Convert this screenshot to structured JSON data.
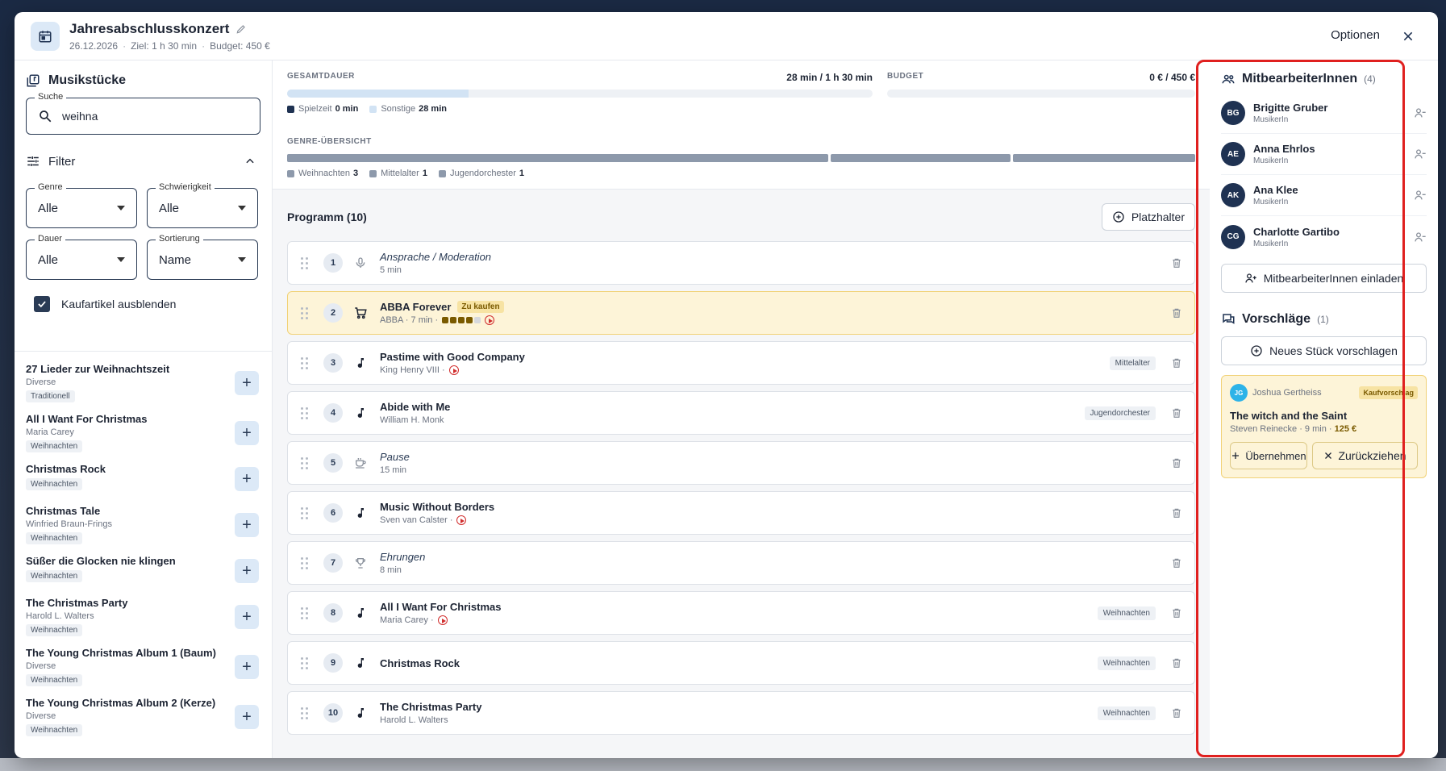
{
  "header": {
    "title": "Jahresabschlusskonzert",
    "date": "26.12.2026",
    "target": "Ziel: 1 h 30 min",
    "budget": "Budget: 450 €",
    "options_label": "Optionen",
    "icon": "calendar-icon"
  },
  "left": {
    "title": "Musikstücke",
    "search": {
      "legend": "Suche",
      "value": "weihna"
    },
    "filter_label": "Filter",
    "selects": [
      {
        "legend": "Genre",
        "value": "Alle"
      },
      {
        "legend": "Schwierigkeit",
        "value": "Alle"
      },
      {
        "legend": "Dauer",
        "value": "Alle"
      },
      {
        "legend": "Sortierung",
        "value": "Name"
      }
    ],
    "hide_purchase_label": "Kaufartikel ausblenden",
    "hide_purchase_checked": true,
    "songs": [
      {
        "title": "27 Lieder zur Weihnachtszeit",
        "artist": "Diverse",
        "tag": "Traditionell"
      },
      {
        "title": "All I Want For Christmas",
        "artist": "Maria Carey",
        "tag": "Weihnachten"
      },
      {
        "title": "Christmas Rock",
        "artist": "",
        "tag": "Weihnachten"
      },
      {
        "title": "Christmas Tale",
        "artist": "Winfried Braun-Frings",
        "tag": "Weihnachten"
      },
      {
        "title": "Süßer die Glocken nie klingen",
        "artist": "",
        "tag": "Weihnachten"
      },
      {
        "title": "The Christmas Party",
        "artist": "Harold L. Walters",
        "tag": "Weihnachten"
      },
      {
        "title": "The Young Christmas Album 1 (Baum)",
        "artist": "Diverse",
        "tag": "Weihnachten"
      },
      {
        "title": "The Young Christmas Album 2 (Kerze)",
        "artist": "Diverse",
        "tag": "Weihnachten"
      }
    ]
  },
  "stats": {
    "duration_label": "GESAMTDAUER",
    "duration_value": "28 min / 1 h 30 min",
    "duration_fraction": 0.31,
    "budget_label": "BUDGET",
    "budget_value": "0 € / 450 €",
    "budget_fraction": 0,
    "legend_play": "Spielzeit",
    "legend_play_value": "0 min",
    "legend_other": "Sonstige",
    "legend_other_value": "28 min",
    "genre_label": "GENRE-ÜBERSICHT",
    "genres": [
      {
        "name": "Weihnachten",
        "count": "3"
      },
      {
        "name": "Mittelalter",
        "count": "1"
      },
      {
        "name": "Jugendorchester",
        "count": "1"
      }
    ]
  },
  "program": {
    "title": "Programm (10)",
    "placeholder_label": "Platzhalter",
    "items": [
      {
        "num": "1",
        "kind": "mic",
        "title": "Ansprache / Moderation",
        "sub": "5 min",
        "italic": true,
        "tag": ""
      },
      {
        "num": "2",
        "kind": "cart",
        "title": "ABBA Forever",
        "sub": "ABBA · 7 min ·",
        "buy_tag": "Zu kaufen",
        "difficulty": 4,
        "play": true,
        "tag": ""
      },
      {
        "num": "3",
        "kind": "note",
        "title": "Pastime with Good Company",
        "sub": "King Henry VIII ·",
        "play": true,
        "tag": "Mittelalter"
      },
      {
        "num": "4",
        "kind": "note",
        "title": "Abide with Me",
        "sub": "William H. Monk",
        "tag": "Jugendorchester"
      },
      {
        "num": "5",
        "kind": "cup",
        "title": "Pause",
        "sub": "15 min",
        "italic": true,
        "tag": ""
      },
      {
        "num": "6",
        "kind": "note",
        "title": "Music Without Borders",
        "sub": "Sven van Calster ·",
        "play": true,
        "tag": ""
      },
      {
        "num": "7",
        "kind": "trophy",
        "title": "Ehrungen",
        "sub": "8 min",
        "italic": true,
        "tag": ""
      },
      {
        "num": "8",
        "kind": "note",
        "title": "All I Want For Christmas",
        "sub": "Maria Carey ·",
        "play": true,
        "tag": "Weihnachten"
      },
      {
        "num": "9",
        "kind": "note",
        "title": "Christmas Rock",
        "sub": "",
        "tag": "Weihnachten"
      },
      {
        "num": "10",
        "kind": "note",
        "title": "The Christmas Party",
        "sub": "Harold L. Walters",
        "tag": "Weihnachten"
      }
    ]
  },
  "right": {
    "members_title": "MitbearbeiterInnen",
    "members_count": "(4)",
    "members": [
      {
        "initials": "BG",
        "name": "Brigitte Gruber",
        "role": "MusikerIn"
      },
      {
        "initials": "AE",
        "name": "Anna Ehrlos",
        "role": "MusikerIn"
      },
      {
        "initials": "AK",
        "name": "Ana Klee",
        "role": "MusikerIn"
      },
      {
        "initials": "CG",
        "name": "Charlotte Gartibo",
        "role": "MusikerIn"
      }
    ],
    "invite_label": "MitbearbeiterInnen einladen",
    "suggestions_title": "Vorschläge",
    "suggestions_count": "(1)",
    "new_suggestion_label": "Neues Stück vorschlagen",
    "suggestion": {
      "initials": "JG",
      "user": "Joshua Gertheiss",
      "tag": "Kaufvorschlag",
      "title": "The witch and the Saint",
      "sub": "Steven Reinecke · 9 min ·",
      "price": "125 €",
      "accept_label": "Übernehmen",
      "withdraw_label": "Zurückziehen"
    }
  },
  "colors": {
    "accent": "#1f3252",
    "highlight": "#e0201f",
    "buy": "#fdf4d8"
  }
}
